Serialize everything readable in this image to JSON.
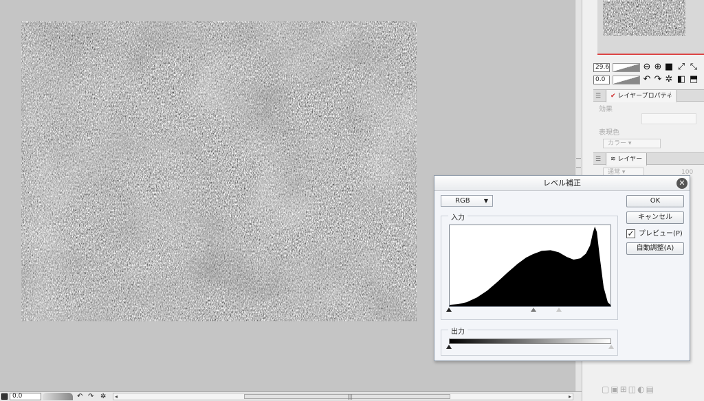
{
  "dialog": {
    "title": "レベル補正",
    "channel_select": "RGB",
    "input_label": "入力",
    "output_label": "出力",
    "ok_label": "OK",
    "cancel_label": "キャンセル",
    "preview_label": "プレビュー(P)",
    "preview_checked": true,
    "auto_label": "自動調整(A)",
    "input_levels": {
      "shadow": 0,
      "midtone": 0.52,
      "highlight": 0.68
    },
    "output_levels": {
      "black": 0,
      "white": 1
    },
    "histogram_color": "#000000"
  },
  "panel": {
    "nav_zoom": "29.6",
    "nav_rotate": "0.0",
    "layer_property_tab": "レイヤープロパティ",
    "effect_label": "効果",
    "expression_color_label": "表現色",
    "color_select": "カラー",
    "layer_tab": "レイヤー",
    "blend_mode": "通常",
    "opacity": "100"
  },
  "status": {
    "zoom_value": "0.0"
  },
  "colors": {
    "background": "#c5c5c5",
    "panel": "#f0f0f0",
    "navigator_accent": "#d44444",
    "dialog_bg": "#f3f5f9"
  }
}
